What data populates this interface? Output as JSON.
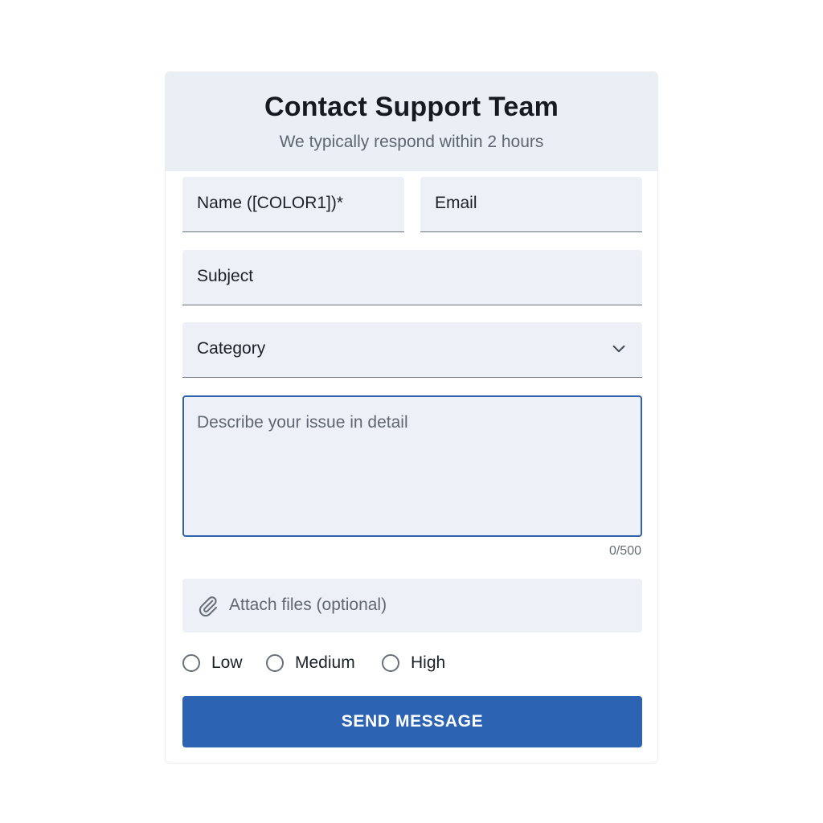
{
  "header": {
    "title": "Contact Support Team",
    "subtitle": "We typically respond within 2 hours"
  },
  "form": {
    "name_label": "Name ([COLOR1])*",
    "email_label": "Email",
    "subject_label": "Subject",
    "category_label": "Category",
    "description_placeholder": "Describe your issue in detail",
    "char_counter": "0/500",
    "attach_label": "Attach files (optional)",
    "priority_options": [
      "Low",
      "Medium",
      "High"
    ],
    "submit_label": "SEND MESSAGE"
  },
  "icons": {
    "category": "chevron-down-icon",
    "attach": "paperclip-icon"
  },
  "colors": {
    "primary": "#2c63b2",
    "header_bg": "#eaeff6",
    "field_bg": "#edf1f7",
    "focus_border": "#2f63a8"
  }
}
